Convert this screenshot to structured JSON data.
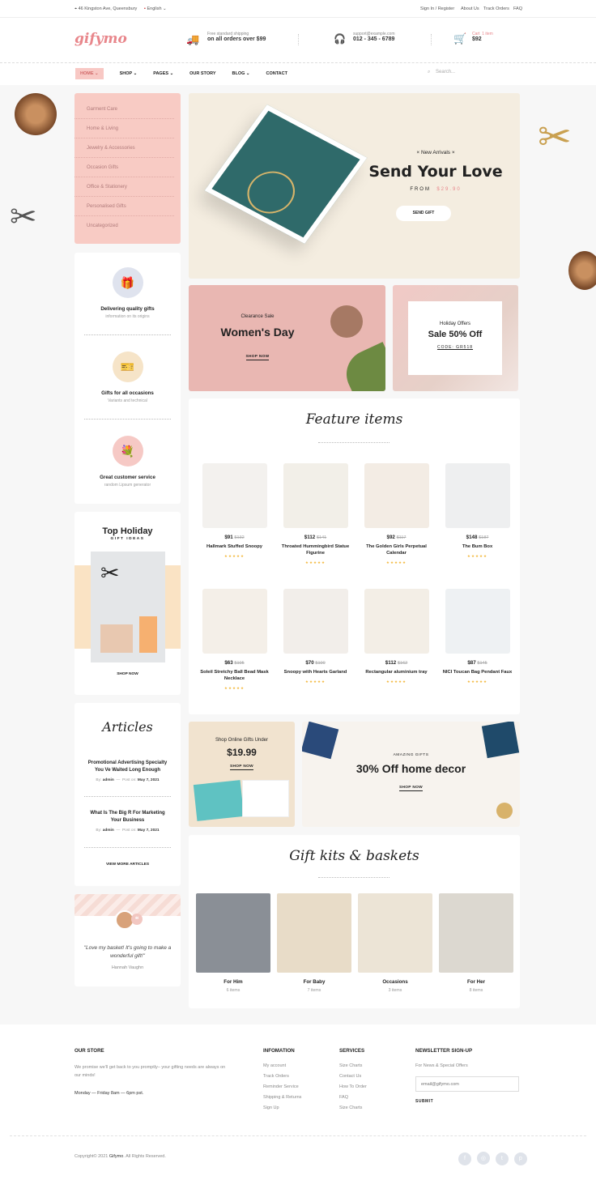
{
  "topbar": {
    "address": "46 Kingston Ave, Queensbury",
    "language": "English",
    "signin": "Sign In / Register",
    "about": "About Us",
    "track": "Track Orders",
    "faq": "FAQ"
  },
  "header": {
    "logo": "gifymo",
    "shipping_small": "Free standard shipping",
    "shipping_big": "on all orders over $99",
    "support_small": "support@example.com",
    "support_big": "012 - 345 - 6789",
    "cart_label": "Cart",
    "cart_items": "1 item",
    "cart_total": "$92"
  },
  "nav": {
    "items": [
      "HOME",
      "SHOP",
      "PAGES",
      "OUR STORY",
      "BLOG",
      "CONTACT"
    ],
    "search_placeholder": "Search..."
  },
  "categories": [
    "Garment Care",
    "Home & Living",
    "Jewelry & Accessories",
    "Occasion Gifts",
    "Office & Stationery",
    "Personalised Gifts",
    "Uncategorized"
  ],
  "hero": {
    "tag": "New Arrivals",
    "title": "Send Your Love",
    "from_label": "FROM",
    "price": "$29.90",
    "button": "SEND GIFT"
  },
  "banner_women": {
    "small": "Clearance Sale",
    "title": "Women's Day",
    "button": "SHOP NOW"
  },
  "banner_holiday": {
    "small": "Holiday Offers",
    "title": "Sale 50% Off",
    "code": "CODE: GR518"
  },
  "features": [
    {
      "title": "Delivering quality gifts",
      "sub": "information on its origins"
    },
    {
      "title": "Gifts for all occasions",
      "sub": "Variants and technical"
    },
    {
      "title": "Great customer service",
      "sub": "random Lipsum generator"
    }
  ],
  "top_holiday": {
    "title": "Top Holiday",
    "sub": "GIFT IDEAS",
    "button": "SHOP NOW"
  },
  "featured": {
    "title": "Feature items",
    "products": [
      {
        "price": "$91",
        "old": "$132",
        "name": "Hallmark Stuffed Snoopy"
      },
      {
        "price": "$112",
        "old": "$141",
        "name": "Throated Hummingbird Statue Figurine"
      },
      {
        "price": "$92",
        "old": "$117",
        "name": "The Golden Girls Perpetual Calendar"
      },
      {
        "price": "$148",
        "old": "$187",
        "name": "The Bum Box"
      },
      {
        "price": "$63",
        "old": "$105",
        "name": "Soleil Stretchy Ball Bead Mask Necklace"
      },
      {
        "price": "$70",
        "old": "$100",
        "name": "Snoopy with Hearts Garland"
      },
      {
        "price": "$112",
        "old": "$162",
        "name": "Rectangular aluminium tray"
      },
      {
        "price": "$87",
        "old": "$145",
        "name": "NICI Toucan Bag Pendant Faux"
      }
    ]
  },
  "articles": {
    "title": "Articles",
    "by": "By:",
    "posted": "Post on:",
    "items": [
      {
        "title": "Promotional Advertising Specialty You Ve Waited Long Enough",
        "author": "admin",
        "date": "May 7, 2021"
      },
      {
        "title": "What Is The Big R For Marketing Your Business",
        "author": "admin",
        "date": "May 7, 2021"
      }
    ],
    "more": "VIEW MORE ARTICLES"
  },
  "testimonial": {
    "quote": "\"Love my basket! It's going to make a wonderful gift!\"",
    "author": "Hannah Vaughn"
  },
  "promo_online": {
    "small": "Shop Online Gifts Under",
    "price": "$19.99",
    "button": "SHOP NOW"
  },
  "promo_decor": {
    "small": "AMAZING GIFTS",
    "title": "30% Off home decor",
    "button": "SHOP NOW"
  },
  "kits": {
    "title": "Gift kits & baskets",
    "items": [
      {
        "title": "For Him",
        "count": "6 items"
      },
      {
        "title": "For Baby",
        "count": "7 items"
      },
      {
        "title": "Occasions",
        "count": "3 items"
      },
      {
        "title": "For Her",
        "count": "8 items"
      }
    ]
  },
  "footer": {
    "store_title": "OUR STORE",
    "store_text": "We promise we'll get back to you promptly– your gifting needs are always on our minds!",
    "hours": "Monday — Friday 8am — 6pm pst.",
    "info_title": "INFOMATION",
    "info_links": [
      "My account",
      "Track Orders",
      "Reminder Service",
      "Shipping & Returns",
      "Sign Up"
    ],
    "services_title": "SERVICES",
    "services_links": [
      "Size Charts",
      "Contact Us",
      "How To Order",
      "FAQ",
      "Size Charts"
    ],
    "newsletter_title": "NEWSLETTER SIGN-UP",
    "newsletter_sub": "For News & Special Offers",
    "email_placeholder": "email@gifymo.com",
    "submit": "SUBMIT",
    "copyright_pre": "Copyright© 2021",
    "copyright_brand": "Gifymo",
    "copyright_post": ". All Rights Reserved."
  },
  "colors": {
    "accent": "#e8868b",
    "pink_panel": "#f8cbc4",
    "hero_bg": "#f4ede0"
  }
}
